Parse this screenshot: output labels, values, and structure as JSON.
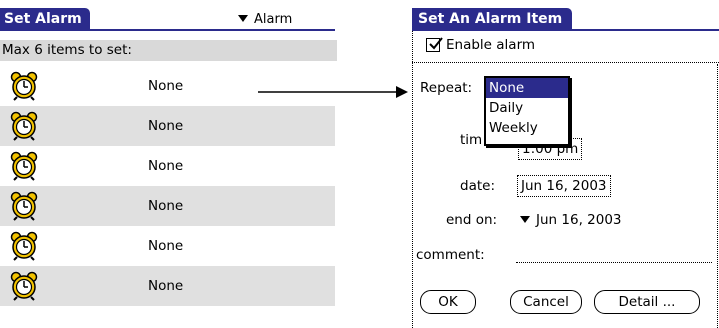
{
  "left_screen": {
    "title": "Set Alarm",
    "category_label": "Alarm",
    "subtitle": "Max 6 items to set:",
    "alarm_items": [
      {
        "label": "None",
        "icon": "alarm-clock-icon"
      },
      {
        "label": "None",
        "icon": "alarm-clock-icon"
      },
      {
        "label": "None",
        "icon": "alarm-clock-icon"
      },
      {
        "label": "None",
        "icon": "alarm-clock-icon"
      },
      {
        "label": "None",
        "icon": "alarm-clock-icon"
      },
      {
        "label": "None",
        "icon": "alarm-clock-icon"
      }
    ]
  },
  "right_screen": {
    "title": "Set An Alarm Item",
    "enable_alarm_label": "Enable alarm",
    "enable_alarm_checked": true,
    "repeat_label": "Repeat:",
    "repeat_options": [
      "None",
      "Daily",
      "Weekly"
    ],
    "repeat_selected": "None",
    "time_label": "tim",
    "time_value": "1:00 pm",
    "date_label": "date:",
    "date_value": "Jun 16, 2003",
    "end_on_label": "end on:",
    "end_on_value": "Jun 16, 2003",
    "comment_label": "comment:",
    "comment_value": "",
    "buttons": {
      "ok": "OK",
      "cancel": "Cancel",
      "detail": "Detail ..."
    }
  },
  "colors": {
    "title_bar": "#2b2b8c",
    "row_shade": "#e0e0e0",
    "clock_yellow": "#f2c200"
  }
}
